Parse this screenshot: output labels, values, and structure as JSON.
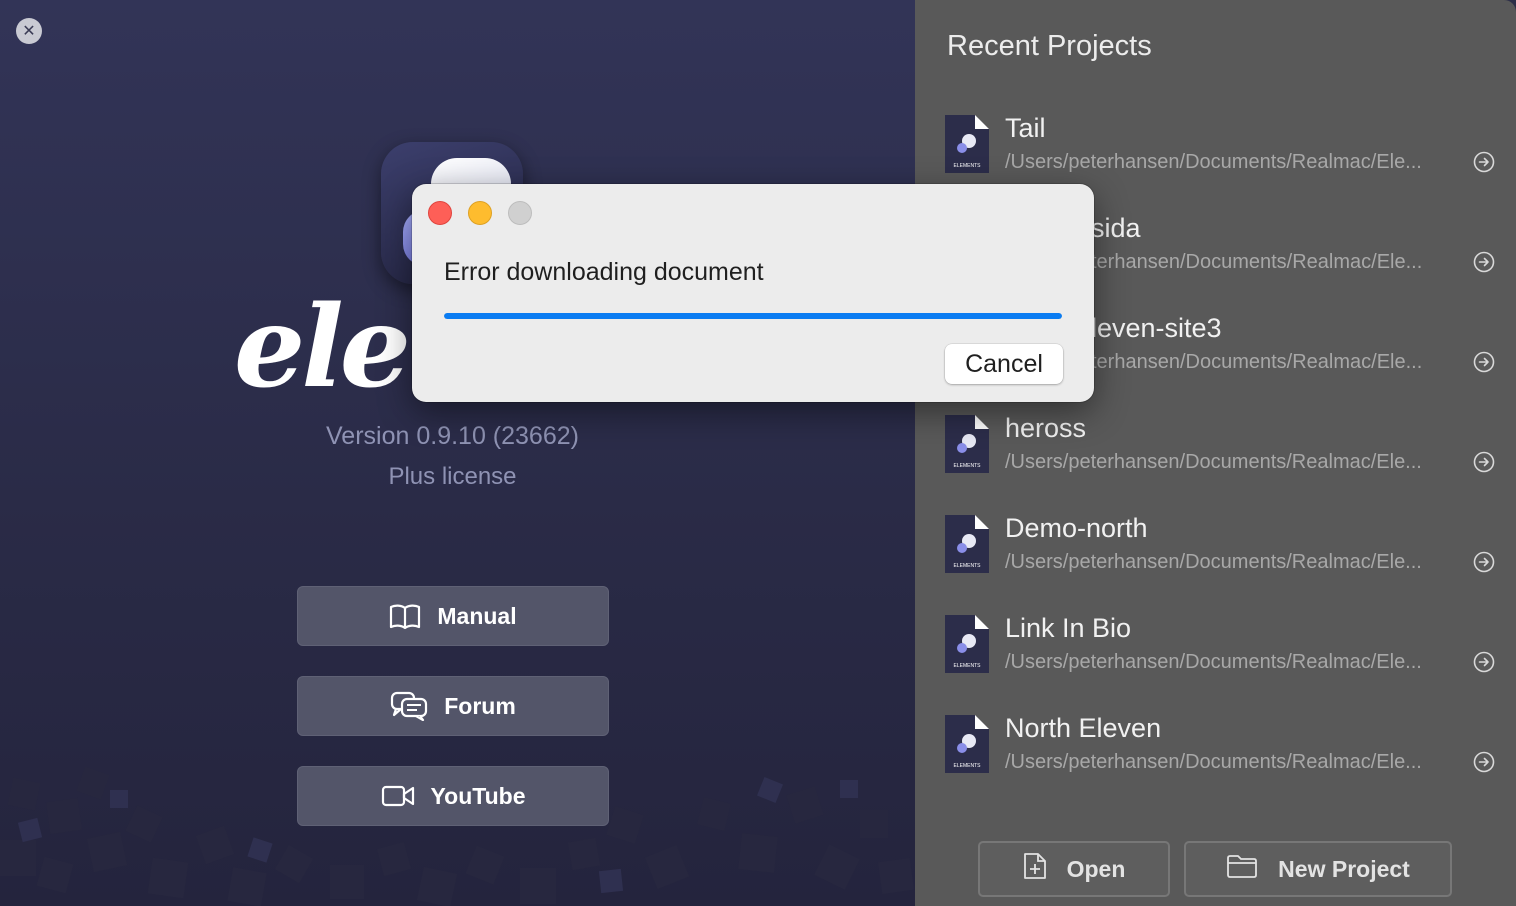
{
  "welcome": {
    "close_symbol": "✕",
    "wordmark": "eler",
    "version": "Version 0.9.10 (23662)",
    "license": "Plus license",
    "buttons": {
      "manual": "Manual",
      "forum": "Forum",
      "youtube": "YouTube"
    }
  },
  "recent": {
    "title": "Recent Projects",
    "items": [
      {
        "name": "Tail",
        "path": "/Users/peterhansen/Documents/Realmac/Ele..."
      },
      {
        "name": "sida",
        "path": "terhansen/Documents/Realmac/Ele..."
      },
      {
        "name": "leven-site3",
        "path": "terhansen/Documents/Realmac/Ele..."
      },
      {
        "name": "heross",
        "path": "/Users/peterhansen/Documents/Realmac/Ele..."
      },
      {
        "name": "Demo-north",
        "path": "/Users/peterhansen/Documents/Realmac/Ele..."
      },
      {
        "name": "Link In Bio",
        "path": "/Users/peterhansen/Documents/Realmac/Ele..."
      },
      {
        "name": "North Eleven",
        "path": "/Users/peterhansen/Documents/Realmac/Ele..."
      }
    ],
    "doc_icon_label": "ELEMENTS",
    "open_label": "Open",
    "new_project_label": "New Project"
  },
  "dialog": {
    "message": "Error downloading document",
    "progress_fraction": 1.0,
    "cancel_label": "Cancel"
  },
  "colors": {
    "progress": "#0a7cf2",
    "traffic_close": "#fe5f57",
    "traffic_minimize": "#febc2e",
    "traffic_zoom_disabled": "#d0d0d0"
  },
  "icons": {
    "close": "close-icon",
    "manual": "book-icon",
    "forum": "chat-bubbles-icon",
    "youtube": "video-camera-icon",
    "project_arrow": "arrow-right-circle-icon",
    "open": "file-plus-icon",
    "new_project": "folder-icon"
  }
}
